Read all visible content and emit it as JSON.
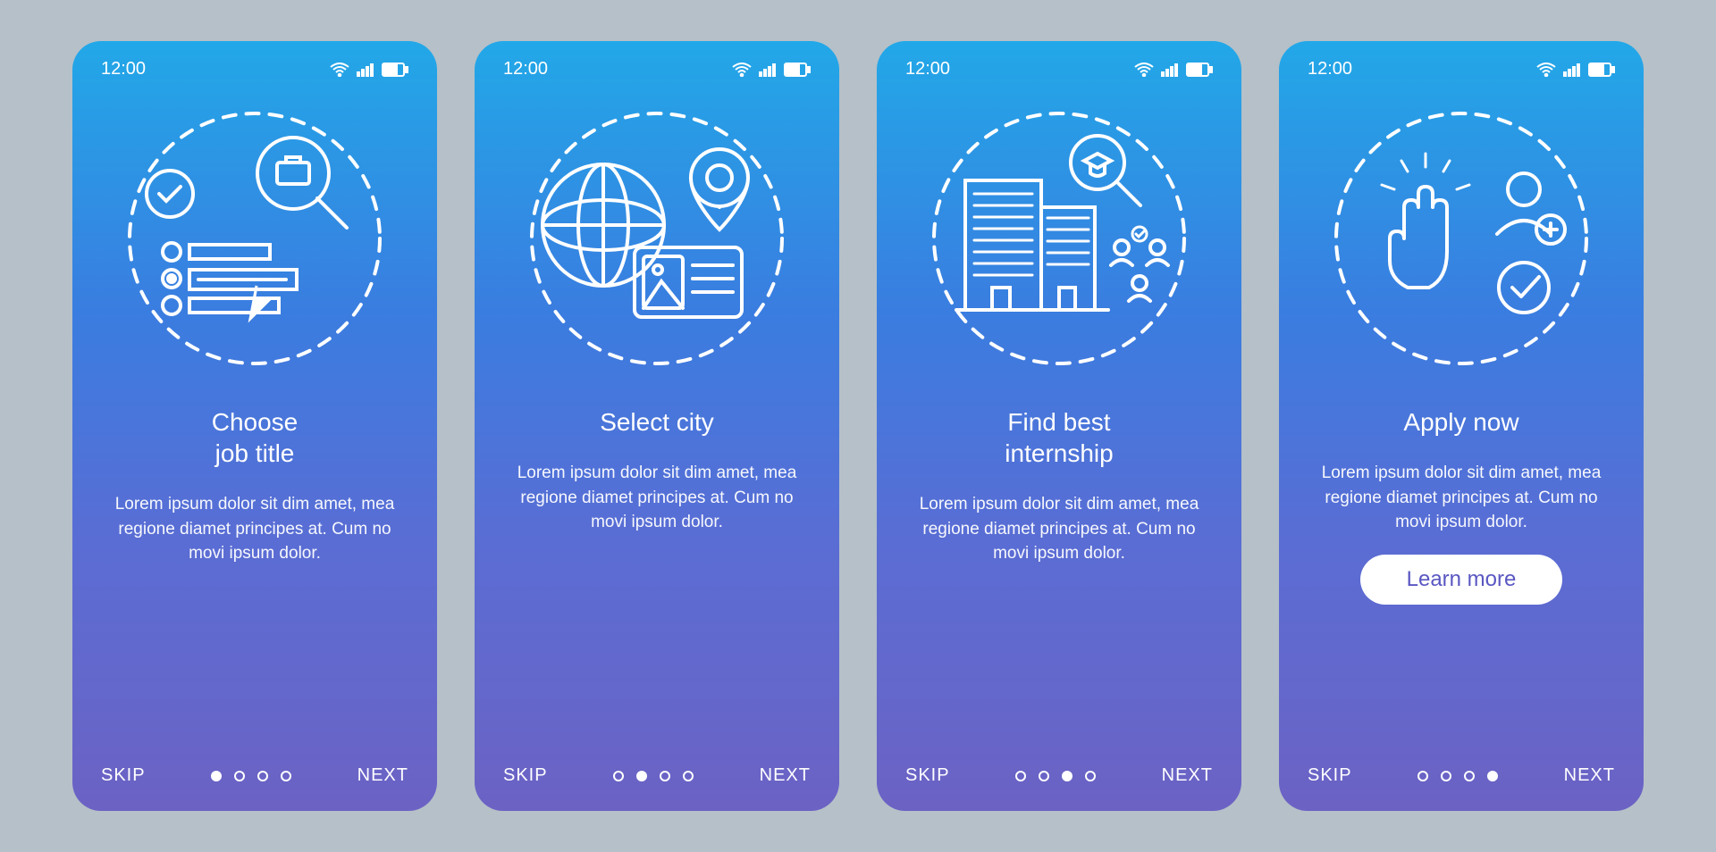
{
  "statusbar": {
    "time": "12:00"
  },
  "nav": {
    "skip": "SKIP",
    "next": "NEXT"
  },
  "body_text": "Lorem ipsum dolor sit dim amet, mea regione diamet principes at. Cum no movi ipsum dolor.",
  "cta": {
    "learn_more": "Learn more"
  },
  "screens": [
    {
      "title": "Choose\njob title",
      "active_dot": 0,
      "icon": "choose-job-title-icon",
      "has_cta": false
    },
    {
      "title": "Select city",
      "active_dot": 1,
      "icon": "select-city-icon",
      "has_cta": false
    },
    {
      "title": "Find best\ninternship",
      "active_dot": 2,
      "icon": "find-internship-icon",
      "has_cta": false
    },
    {
      "title": "Apply now",
      "active_dot": 3,
      "icon": "apply-now-icon",
      "has_cta": true
    }
  ],
  "colors": {
    "background": "#b5c0c8",
    "gradient_top": "#22a8e8",
    "gradient_bottom": "#6c62c4",
    "cta_bg": "#ffffff",
    "cta_text": "#5a57c2"
  }
}
